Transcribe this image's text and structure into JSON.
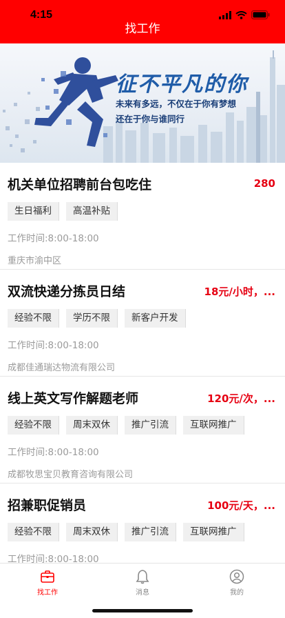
{
  "status_bar": {
    "time": "4:15"
  },
  "header": {
    "title": "找工作"
  },
  "banner": {
    "slogan": "征不平凡的你",
    "line1": "未来有多远，不仅在于你有梦想",
    "line2": "还在于你与谁同行"
  },
  "jobs": [
    {
      "title": "机关单位招聘前台包吃住",
      "salary": "280",
      "tags": [
        "生日福利",
        "高温补贴"
      ],
      "hours": "工作时间:8:00-18:00",
      "company": "重庆市渝中区"
    },
    {
      "title": "双流快递分拣员日结",
      "salary": "18元/小时，...",
      "tags": [
        "经验不限",
        "学历不限",
        "新客户开发"
      ],
      "hours": "工作时间:8:00-18:00",
      "company": "成都佳通瑞达物流有限公司"
    },
    {
      "title": "线上英文写作解题老师",
      "salary": "120元/次，...",
      "tags": [
        "经验不限",
        "周末双休",
        "推广引流",
        "互联网推广"
      ],
      "hours": "工作时间:8:00-18:00",
      "company": "成都牧思宝贝教育咨询有限公司"
    },
    {
      "title": "招兼职促销员",
      "salary": "100元/天，...",
      "tags": [
        "经验不限",
        "周末双休",
        "推广引流",
        "互联网推广"
      ],
      "hours": "工作时间:8:00-18:00",
      "company": ""
    }
  ],
  "tabbar": {
    "items": [
      {
        "label": "找工作",
        "icon": "briefcase-icon",
        "active": true
      },
      {
        "label": "消息",
        "icon": "bell-icon",
        "active": false
      },
      {
        "label": "我的",
        "icon": "user-icon",
        "active": false
      }
    ]
  },
  "colors": {
    "brand": "#ff0000",
    "salary": "#e60012",
    "tag_bg": "#f0f0f0",
    "muted_text": "#9a9a9a"
  }
}
